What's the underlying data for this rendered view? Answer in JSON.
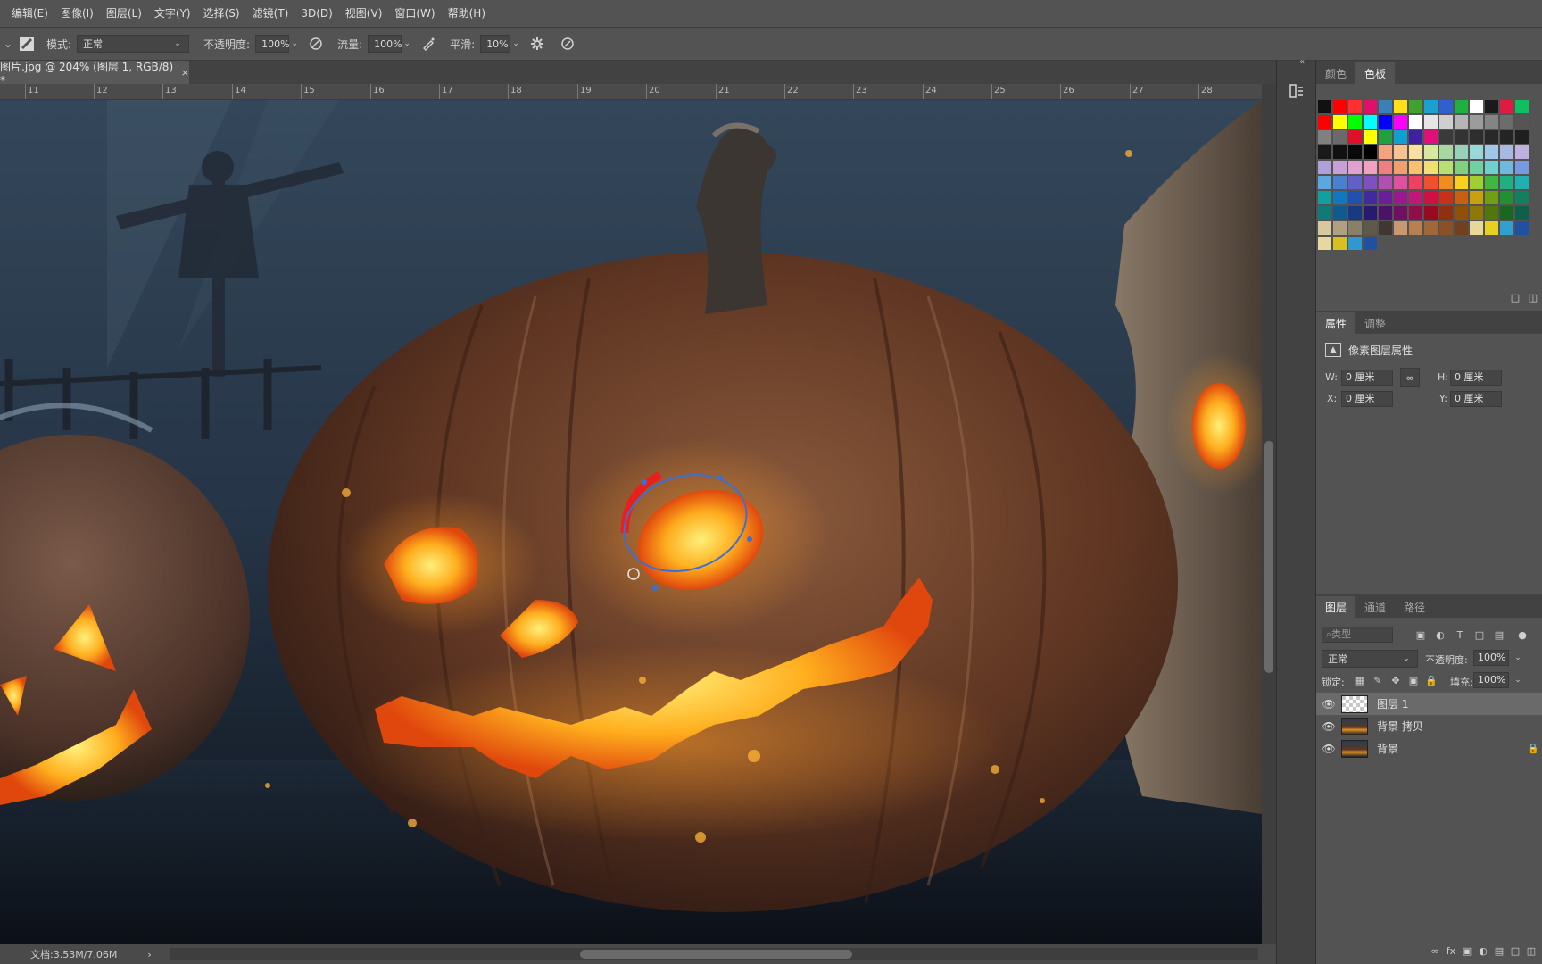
{
  "menu": [
    "编辑(E)",
    "图像(I)",
    "图层(L)",
    "文字(Y)",
    "选择(S)",
    "滤镜(T)",
    "3D(D)",
    "视图(V)",
    "窗口(W)",
    "帮助(H)"
  ],
  "options": {
    "mode_label": "模式:",
    "mode_value": "正常",
    "opacity_label": "不透明度:",
    "opacity_value": "100%",
    "flow_label": "流量:",
    "flow_value": "100%",
    "smooth_label": "平滑:",
    "smooth_value": "10%"
  },
  "document": {
    "tab_title": "图片.jpg @ 204% (图层 1, RGB/8) *",
    "close_glyph": "×"
  },
  "ruler_ticks": [
    "11",
    "12",
    "13",
    "14",
    "15",
    "16",
    "17",
    "18",
    "19",
    "20",
    "21",
    "22",
    "23",
    "24",
    "25",
    "26",
    "27",
    "28"
  ],
  "status": {
    "doc_size": "文档:3.53M/7.06M",
    "arrow": "›"
  },
  "swatch_panel": {
    "tabs": [
      "颜色",
      "色板"
    ],
    "active_tab": 1
  },
  "properties": {
    "tabs": [
      "属性",
      "调整"
    ],
    "active_tab": 0,
    "heading": "像素图层属性",
    "w_label": "W:",
    "w_value": "0 厘米",
    "h_label": "H:",
    "h_value": "0 厘米",
    "x_label": "X:",
    "x_value": "0 厘米",
    "y_label": "Y:",
    "y_value": "0 厘米"
  },
  "layers": {
    "tabs": [
      "图层",
      "通道",
      "路径"
    ],
    "active_tab": 0,
    "filter_placeholder": "类型",
    "blend_mode": "正常",
    "opacity_label": "不透明度:",
    "opacity_value": "100%",
    "lock_label": "锁定:",
    "fill_label": "填充:",
    "fill_value": "100%",
    "items": [
      {
        "name": "图层 1",
        "selected": true,
        "locked": false,
        "thumb": "transparent"
      },
      {
        "name": "背景 拷贝",
        "selected": false,
        "locked": false,
        "thumb": "image"
      },
      {
        "name": "背景",
        "selected": false,
        "locked": true,
        "thumb": "image"
      }
    ]
  },
  "colors": {
    "accent_selection": "#3b6fd8",
    "glow": "#ffb41e",
    "pumpkin": "#6e3c24"
  }
}
